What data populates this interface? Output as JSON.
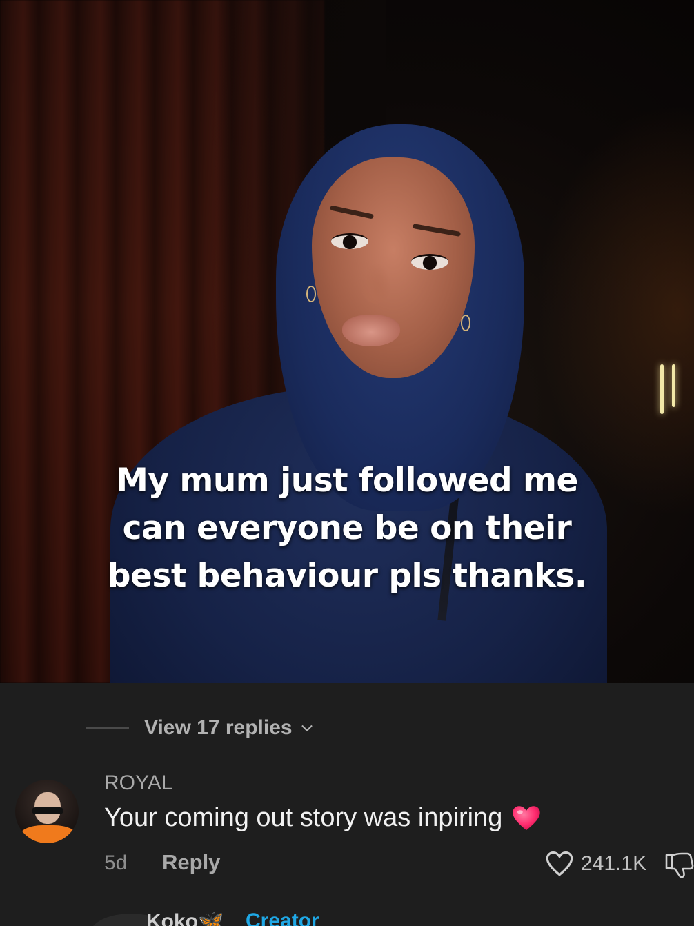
{
  "video": {
    "caption_lines": [
      "My mum just followed me",
      "can everyone be on their",
      "best behaviour pls thanks."
    ]
  },
  "comments": {
    "view_replies_label": "View 17 replies",
    "comment": {
      "username": "ROYAL",
      "text": "Your coming out story was inpiring",
      "emoji": "heart-emoji",
      "time": "5d",
      "reply_label": "Reply",
      "like_count": "241.1K"
    },
    "next_comment": {
      "username": "Koko🦋",
      "badge": "Creator"
    }
  },
  "colors": {
    "panel_bg": "#1e1e1e",
    "emoji_heart": "#ff2d6f",
    "creator_badge": "#1fa8e6"
  }
}
